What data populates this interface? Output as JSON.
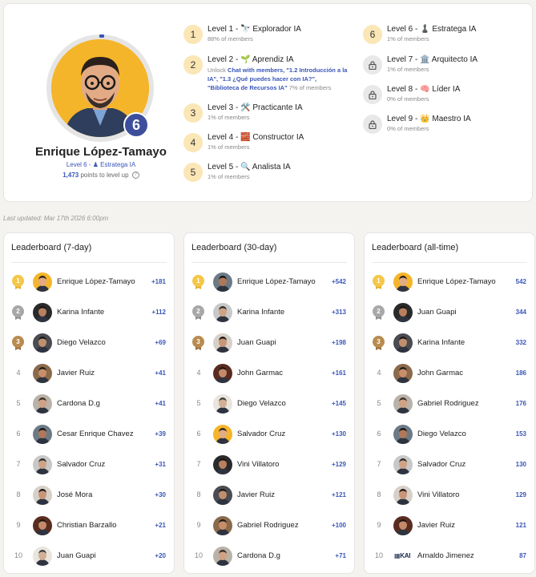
{
  "profile": {
    "name": "Enrique López-Tamayo",
    "level_badge": "6",
    "level_number": "Level 6 -",
    "level_name": "Estratega IA",
    "points_to_level": "1,473",
    "points_suffix": "points to level up"
  },
  "levels": [
    {
      "num": "1",
      "title": "Level 1 - 🔭 Explorador IA",
      "sub": "88% of members",
      "locked": false
    },
    {
      "num": "2",
      "title": "Level 2 - 🌱 Aprendiz IA",
      "unlock_prefix": "Unlock",
      "unlock_links": "Chat with members, \"1.2 Introducción a la IA\", \"1.3 ¿Qué puedes hacer con IA?\", \"Biblioteca de Recursos IA\"",
      "sub": "7% of members",
      "locked": false
    },
    {
      "num": "3",
      "title": "Level 3 - 🛠️ Practicante IA",
      "sub": "1% of members",
      "locked": false
    },
    {
      "num": "4",
      "title": "Level 4 - 🧱 Constructor IA",
      "sub": "1% of members",
      "locked": false
    },
    {
      "num": "5",
      "title": "Level 5 - 🔍 Analista IA",
      "sub": "1% of members",
      "locked": false
    },
    {
      "num": "6",
      "title": "Level 6 - ♟️ Estratega IA",
      "sub": "1% of members",
      "locked": false
    },
    {
      "num": "",
      "title": "Level 7 - 🏛️ Arquitecto IA",
      "sub": "1% of members",
      "locked": true
    },
    {
      "num": "",
      "title": "Level 8 - 🧠 Líder IA",
      "sub": "0% of members",
      "locked": true
    },
    {
      "num": "",
      "title": "Level 9 - 👑 Maestro IA",
      "sub": "0% of members",
      "locked": true
    }
  ],
  "last_updated": "Last updated: Mar 17th 2026 6:00pm",
  "leaderboards": [
    {
      "title": "Leaderboard (7-day)",
      "rows": [
        {
          "rank": "1",
          "name": "Enrique López-Tamayo",
          "points": "+181"
        },
        {
          "rank": "2",
          "name": "Karina Infante",
          "points": "+112"
        },
        {
          "rank": "3",
          "name": "Diego Velazco",
          "points": "+69"
        },
        {
          "rank": "4",
          "name": "Javier Ruiz",
          "points": "+41"
        },
        {
          "rank": "5",
          "name": "Cardona D.g",
          "points": "+41"
        },
        {
          "rank": "6",
          "name": "Cesar Enrique Chavez",
          "points": "+39"
        },
        {
          "rank": "7",
          "name": "Salvador Cruz",
          "points": "+31"
        },
        {
          "rank": "8",
          "name": "José Mora",
          "points": "+30"
        },
        {
          "rank": "9",
          "name": "Christian Barzallo",
          "points": "+21"
        },
        {
          "rank": "10",
          "name": "Juan Guapi",
          "points": "+20"
        }
      ]
    },
    {
      "title": "Leaderboard (30-day)",
      "rows": [
        {
          "rank": "1",
          "name": "Enrique López-Tamayo",
          "points": "+542"
        },
        {
          "rank": "2",
          "name": "Karina Infante",
          "points": "+313"
        },
        {
          "rank": "3",
          "name": "Juan Guapi",
          "points": "+198"
        },
        {
          "rank": "4",
          "name": "John Garmac",
          "points": "+161"
        },
        {
          "rank": "5",
          "name": "Diego Velazco",
          "points": "+145"
        },
        {
          "rank": "6",
          "name": "Salvador Cruz",
          "points": "+130"
        },
        {
          "rank": "7",
          "name": "Vini Villatoro",
          "points": "+129"
        },
        {
          "rank": "8",
          "name": "Javier Ruiz",
          "points": "+121"
        },
        {
          "rank": "9",
          "name": "Gabriel Rodriguez",
          "points": "+100"
        },
        {
          "rank": "10",
          "name": "Cardona D.g",
          "points": "+71"
        }
      ]
    },
    {
      "title": "Leaderboard (all-time)",
      "rows": [
        {
          "rank": "1",
          "name": "Enrique López-Tamayo",
          "points": "542"
        },
        {
          "rank": "2",
          "name": "Juan Guapi",
          "points": "344"
        },
        {
          "rank": "3",
          "name": "Karina Infante",
          "points": "332"
        },
        {
          "rank": "4",
          "name": "John Garmac",
          "points": "186"
        },
        {
          "rank": "5",
          "name": "Gabriel Rodriguez",
          "points": "176"
        },
        {
          "rank": "6",
          "name": "Diego Velazco",
          "points": "153"
        },
        {
          "rank": "7",
          "name": "Salvador Cruz",
          "points": "130"
        },
        {
          "rank": "8",
          "name": "Vini Villatoro",
          "points": "129"
        },
        {
          "rank": "9",
          "name": "Javier Ruiz",
          "points": "121"
        },
        {
          "rank": "10",
          "name": "Arnaldo Jimenez",
          "points": "87",
          "logo": "KAI"
        }
      ]
    }
  ],
  "colors": {
    "accent": "#3a56b8",
    "level_badge": "#3d4f9c",
    "level_circle": "#fbe6b5",
    "locked_circle": "#e8e8e8",
    "gold": "#f4c64a",
    "silver": "#a8a8a8",
    "bronze": "#b98b50"
  }
}
